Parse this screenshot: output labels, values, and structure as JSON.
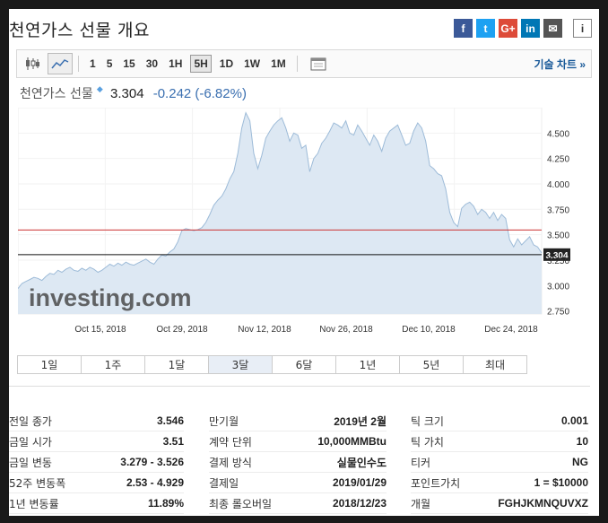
{
  "title": "천연가스 선물 개요",
  "social": [
    {
      "icon": "facebook-icon",
      "glyph": "f",
      "color": "#3b5998"
    },
    {
      "icon": "twitter-icon",
      "glyph": "t",
      "color": "#1da1f2"
    },
    {
      "icon": "google-plus-icon",
      "glyph": "G+",
      "color": "#dd4b39"
    },
    {
      "icon": "linkedin-icon",
      "glyph": "in",
      "color": "#0077b5"
    },
    {
      "icon": "email-icon",
      "glyph": "✉",
      "color": "#555555"
    },
    {
      "icon": "info-icon",
      "glyph": "i",
      "color": "#ffffff"
    }
  ],
  "toolbar": {
    "intervals": [
      "1",
      "5",
      "15",
      "30",
      "1H",
      "5H",
      "1D",
      "1W",
      "1M"
    ],
    "active_interval": "5H",
    "tech_chart_label": "기술 차트 »"
  },
  "quote": {
    "name": "천연가스 선물",
    "price": "3.304",
    "change": "-0.242 (-6.82%)"
  },
  "colors": {
    "accent": "#3a6fb0",
    "area_fill": "#dde8f3",
    "line": "#9dbbd8",
    "red_line": "#cc3333"
  },
  "chart_data": {
    "type": "area",
    "watermark": "investing.com",
    "x_labels": [
      "Oct 15, 2018",
      "Oct 29, 2018",
      "Nov 12, 2018",
      "Nov 26, 2018",
      "Dec 10, 2018",
      "Dec 24, 2018"
    ],
    "y_ticks": [
      "4.500",
      "4.250",
      "4.000",
      "3.750",
      "3.500",
      "3.250",
      "3.000",
      "2.750"
    ],
    "ylim": [
      2.72,
      4.75
    ],
    "current_price": 3.304,
    "current_label": "3.304",
    "reference_line": 3.546,
    "values": [
      2.97,
      3.02,
      3.04,
      3.06,
      3.08,
      3.07,
      3.05,
      3.09,
      3.12,
      3.11,
      3.15,
      3.13,
      3.16,
      3.18,
      3.15,
      3.14,
      3.17,
      3.15,
      3.18,
      3.16,
      3.13,
      3.15,
      3.18,
      3.21,
      3.19,
      3.22,
      3.2,
      3.23,
      3.21,
      3.2,
      3.22,
      3.24,
      3.26,
      3.23,
      3.21,
      3.26,
      3.3,
      3.29,
      3.33,
      3.36,
      3.43,
      3.54,
      3.56,
      3.55,
      3.54,
      3.55,
      3.57,
      3.62,
      3.7,
      3.79,
      3.84,
      3.88,
      3.95,
      4.05,
      4.12,
      4.3,
      4.55,
      4.7,
      4.62,
      4.3,
      4.15,
      4.28,
      4.45,
      4.52,
      4.58,
      4.62,
      4.65,
      4.55,
      4.42,
      4.5,
      4.48,
      4.35,
      4.38,
      4.12,
      4.25,
      4.3,
      4.4,
      4.45,
      4.52,
      4.6,
      4.58,
      4.55,
      4.62,
      4.5,
      4.48,
      4.58,
      4.52,
      4.45,
      4.38,
      4.48,
      4.42,
      4.32,
      4.45,
      4.52,
      4.55,
      4.58,
      4.48,
      4.38,
      4.4,
      4.52,
      4.6,
      4.55,
      4.42,
      4.18,
      4.15,
      4.1,
      4.08,
      3.95,
      3.72,
      3.62,
      3.58,
      3.76,
      3.8,
      3.82,
      3.78,
      3.7,
      3.75,
      3.72,
      3.66,
      3.72,
      3.64,
      3.7,
      3.66,
      3.45,
      3.38,
      3.46,
      3.4,
      3.44,
      3.48,
      3.4,
      3.38,
      3.32
    ]
  },
  "ranges": [
    "1일",
    "1주",
    "1달",
    "3달",
    "6달",
    "1년",
    "5년",
    "최대"
  ],
  "active_range": "3달",
  "stats": {
    "col1": [
      {
        "label": "전일 종가",
        "value": "3.546"
      },
      {
        "label": "금일 시가",
        "value": "3.51"
      },
      {
        "label": "금일 변동",
        "value": "3.279 - 3.526"
      },
      {
        "label": "52주 변동폭",
        "value": "2.53 - 4.929"
      },
      {
        "label": "1년 변동률",
        "value": "11.89%"
      }
    ],
    "col2": [
      {
        "label": "만기월",
        "value": "2019년 2월"
      },
      {
        "label": "계약 단위",
        "value": "10,000MMBtu"
      },
      {
        "label": "결제 방식",
        "value": "실물인수도"
      },
      {
        "label": "결제일",
        "value": "2019/01/29"
      },
      {
        "label": "최종 롤오버일",
        "value": "2018/12/23"
      }
    ],
    "col3": [
      {
        "label": "틱 크기",
        "value": "0.001"
      },
      {
        "label": "틱 가치",
        "value": "10"
      },
      {
        "label": "티커",
        "value": "NG"
      },
      {
        "label": "포인트가치",
        "value": "1 = $10000"
      },
      {
        "label": "개월",
        "value": "FGHJKMNQUVXZ"
      }
    ]
  }
}
